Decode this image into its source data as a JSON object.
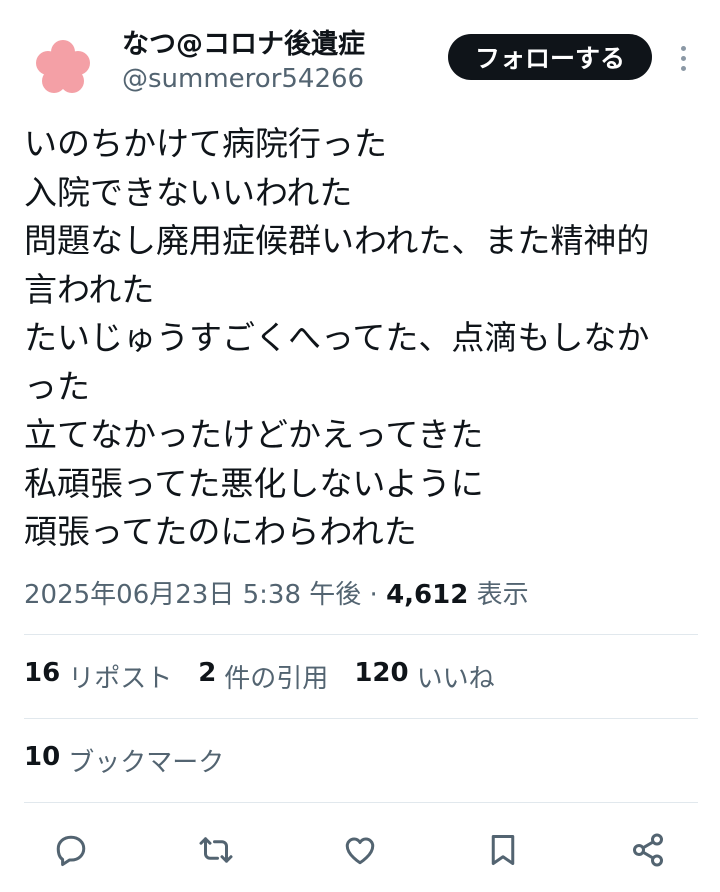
{
  "user": {
    "display_name": "なつ@コロナ後遺症",
    "handle": "@summeror54266",
    "follow_label": "フォローする"
  },
  "tweet": {
    "lines": [
      "いのちかけて病院行った",
      "入院できないいわれた",
      "問題なし廃用症候群いわれた、また精神的",
      "言われた",
      "たいじゅうすごくへってた、点滴もしなか",
      "った",
      "立てなかったけどかえってきた",
      "私頑張ってた悪化しないように",
      "頑張ってたのにわらわれた"
    ],
    "timestamp": "2025年06月23日 5:38 午後",
    "separator": "·",
    "views_count": "4,612",
    "views_label": "表示"
  },
  "stats": {
    "reposts_count": "16",
    "reposts_label": "リポスト",
    "quotes_count": "2",
    "quotes_label": "件の引用",
    "likes_count": "120",
    "likes_label": "いいね",
    "bookmarks_count": "10",
    "bookmarks_label": "ブックマーク"
  },
  "colors": {
    "avatar_pink": "#f4a0a6",
    "text_primary": "#0f1419",
    "text_secondary": "#536471",
    "icon_gray": "#536471"
  },
  "icons": [
    "reply-icon",
    "repost-icon",
    "like-icon",
    "bookmark-icon",
    "share-icon"
  ]
}
